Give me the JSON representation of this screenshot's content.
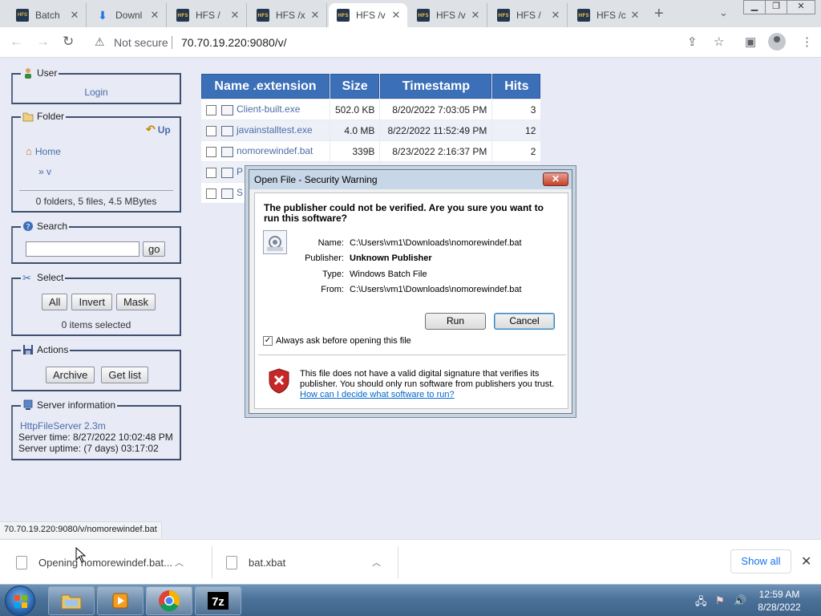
{
  "browser": {
    "tabs": [
      {
        "label": "Batch",
        "favicon": "hfs-icon"
      },
      {
        "label": "Downl",
        "favicon": "download-icon"
      },
      {
        "label": "HFS /",
        "favicon": "hfs-icon"
      },
      {
        "label": "HFS /x",
        "favicon": "hfs-icon"
      },
      {
        "label": "HFS /v",
        "favicon": "hfs-icon"
      },
      {
        "label": "HFS /v",
        "favicon": "hfs-icon"
      },
      {
        "label": "HFS /",
        "favicon": "hfs-icon"
      },
      {
        "label": "HFS /c",
        "favicon": "hfs-icon"
      }
    ],
    "favicon_text": "HFS",
    "security_label": "Not secure",
    "url": "70.70.19.220:9080/v/"
  },
  "hfs": {
    "user": {
      "legend": "User",
      "login": "Login"
    },
    "folder": {
      "legend": "Folder",
      "up": "Up",
      "home": "Home",
      "current": "» v",
      "summary": "0 folders, 5 files, 4.5 MBytes"
    },
    "search": {
      "legend": "Search",
      "value": "",
      "go": "go"
    },
    "select": {
      "legend": "Select",
      "all": "All",
      "invert": "Invert",
      "mask": "Mask",
      "count": "0 items selected"
    },
    "actions": {
      "legend": "Actions",
      "archive": "Archive",
      "getlist": "Get list"
    },
    "server": {
      "legend": "Server information",
      "software": "HttpFileServer 2.3m",
      "time": "Server time: 8/27/2022 10:02:48 PM",
      "uptime": "Server uptime: (7 days) 03:17:02"
    },
    "table": {
      "headers": [
        "Name .extension",
        "Size",
        "Timestamp",
        "Hits"
      ],
      "rows": [
        {
          "name": "Client-built.exe",
          "size": "502.0 KB",
          "timestamp": "8/20/2022 7:03:05 PM",
          "hits": "3"
        },
        {
          "name": "javainstalltest.exe",
          "size": "4.0 MB",
          "timestamp": "8/22/2022 11:52:49 PM",
          "hits": "12"
        },
        {
          "name": "nomorewindef.bat",
          "size": "339B",
          "timestamp": "8/23/2022 2:16:37 PM",
          "hits": "2"
        },
        {
          "name": "P",
          "size": "",
          "timestamp": "",
          "hits": ""
        },
        {
          "name": "S",
          "size": "",
          "timestamp": "",
          "hits": ""
        }
      ]
    }
  },
  "dialog": {
    "title": "Open File - Security Warning",
    "heading": "The publisher could not be verified.  Are you sure you want to run this software?",
    "fields": [
      {
        "key": "Name:",
        "value": "C:\\Users\\vm1\\Downloads\\nomorewindef.bat",
        "bold": false
      },
      {
        "key": "Publisher:",
        "value": "Unknown Publisher",
        "bold": true
      },
      {
        "key": "Type:",
        "value": "Windows Batch File",
        "bold": false
      },
      {
        "key": "From:",
        "value": "C:\\Users\\vm1\\Downloads\\nomorewindef.bat",
        "bold": false
      }
    ],
    "run": "Run",
    "cancel": "Cancel",
    "always_ask": "Always ask before opening this file",
    "always_ask_checked": true,
    "warning": "This file does not have a valid digital signature that verifies its publisher.  You should only run software from publishers you trust.",
    "link": "How can I decide what software to run?"
  },
  "status_url": "70.70.19.220:9080/v/nomorewindef.bat",
  "downloads": {
    "items": [
      {
        "name": "Opening nomorewindef.bat..."
      },
      {
        "name": "bat.xbat"
      }
    ],
    "show_all": "Show all"
  },
  "taskbar": {
    "time": "12:59 AM",
    "date": "8/28/2022",
    "apps": [
      "explorer-icon",
      "media-player-icon",
      "chrome-icon",
      "7zip-icon"
    ]
  },
  "colors": {
    "table_header": "#3b6fb8",
    "page_bg": "#e8eaf6",
    "link": "#4a6da7"
  }
}
